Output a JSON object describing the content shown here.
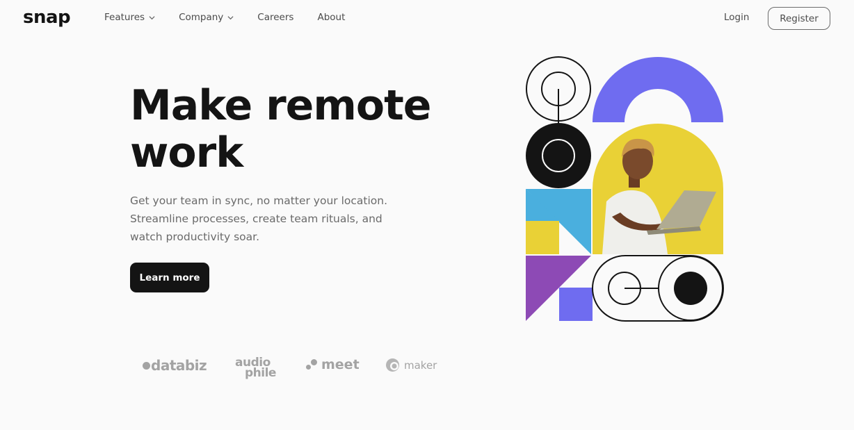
{
  "header": {
    "logo": "snap",
    "nav": [
      {
        "label": "Features",
        "has_dropdown": true,
        "icon": "chevron-down-icon"
      },
      {
        "label": "Company",
        "has_dropdown": true,
        "icon": "chevron-down-icon"
      },
      {
        "label": "Careers",
        "has_dropdown": false
      },
      {
        "label": "About",
        "has_dropdown": false
      }
    ],
    "login_label": "Login",
    "register_label": "Register"
  },
  "hero": {
    "title_line1": "Make remote",
    "title_line2": "work",
    "text_line1": "Get your team in sync, no matter your location.",
    "text_line2": "Streamline processes, create team rituals, and",
    "text_line3": "watch productivity soar.",
    "cta_label": "Learn more"
  },
  "clients": {
    "databiz": "databiz",
    "audiophile_top": "audio",
    "audiophile_bottom": "phile",
    "meet": "meet",
    "maker": "maker"
  },
  "colors": {
    "background": "#fafafa",
    "text_dark": "#141414",
    "text_gray": "#6a6a6a",
    "accent_purple": "#6f6cf0",
    "accent_yellow": "#e9d136",
    "accent_blue": "#4aafde",
    "accent_violet": "#8d4ab5",
    "client_gray": "#a3a3a3"
  }
}
